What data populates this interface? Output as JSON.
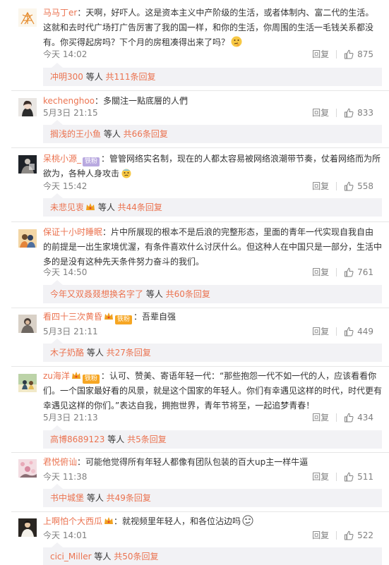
{
  "actions": {
    "reply_label": "回复"
  },
  "comments": [
    {
      "user": "马马丁er",
      "sep": "：",
      "text": "天啊，好吓人。这是资本主义中产阶级的生活，或者体制内、富二代的生活。这就和去时代广场打广告厉害了我的国一样，和你的生活，你周围的生活一毛钱关系都没有。你买得起房吗？下个月的房租凑得出来了吗？",
      "time": "今天 14:02",
      "likes": "875",
      "sub": {
        "nick": "冲明300",
        "mid": " 等人 ",
        "more": "共111条回复"
      }
    },
    {
      "user": "kechenghoo",
      "sep": "：",
      "text": "多關注一點底層的人們",
      "time": "5月3日 21:15",
      "likes": "833",
      "sub": {
        "nick": "搁浅的王小鱼",
        "mid": " 等人 ",
        "more": "共66条回复"
      }
    },
    {
      "user": "呆桃小源_",
      "badge": "铁粉",
      "sep": "：",
      "text": "管管网络实名制，现在的人都太容易被网络浪潮带节奏，仗着网络而为所欲为，各种人身攻击",
      "time": "今天 15:42",
      "likes": "558",
      "sub": {
        "nick": "未悲见衷",
        "mid": " 等人 ",
        "more": "共44条回复"
      }
    },
    {
      "user": "保证十小时睡眠",
      "sep": "：",
      "text": "片中所展现的根本不是后浪的完整形态，里面的青年一代实现自我自由的前提是一出生家境优渥，有条件喜欢什么讨厌什么。但这种人在中国只是一部分，生活中多的是没有这种先天条件努力奋斗的我们。",
      "time": "今天 14:50",
      "likes": "761",
      "sub": {
        "nick": "今年又双叒叕想换名字了",
        "mid": " 等人 ",
        "more": "共60条回复"
      }
    },
    {
      "user": "看四十三次黄昏",
      "badge": "铁粉",
      "sep": "：",
      "text": "吾辈自强",
      "time": "5月3日 21:11",
      "likes": "449",
      "sub": {
        "nick": "木子奶酪",
        "mid": " 等人 ",
        "more": "共27条回复"
      }
    },
    {
      "user": "zu海洋",
      "badge": "铁粉",
      "sep": "：",
      "text": "认可、赞美、寄语年轻一代：“那些抱怨一代不如一代的人，应该看看你们。一个国家最好看的风景，就是这个国家的年轻人。你们有幸遇见这样的时代，时代更有幸遇见这样的你们。”表达自我，拥抱世界，青年节将至，一起追梦青春！",
      "time": "5月3日 21:13",
      "likes": "434",
      "sub": {
        "nick": "高博8689123",
        "mid": " 等人 ",
        "more": "共5条回复"
      }
    },
    {
      "user": "君悦俯讪",
      "sep": "：",
      "text": "可能他觉得所有年轻人都像有团队包装的百大up主一样牛逼",
      "time": "今天 11:38",
      "likes": "511",
      "sub": {
        "nick": "书中城堡",
        "mid": " 等人 ",
        "more": "共49条回复"
      }
    },
    {
      "user": "上啊怕个大西瓜",
      "sep": "：",
      "text": "就视频里年轻人，和各位沾边吗",
      "time": "今天 14:01",
      "likes": "522",
      "sub": {
        "nick": "cici_Miller",
        "mid": " 等人 ",
        "more": "共50条回复"
      }
    }
  ]
}
